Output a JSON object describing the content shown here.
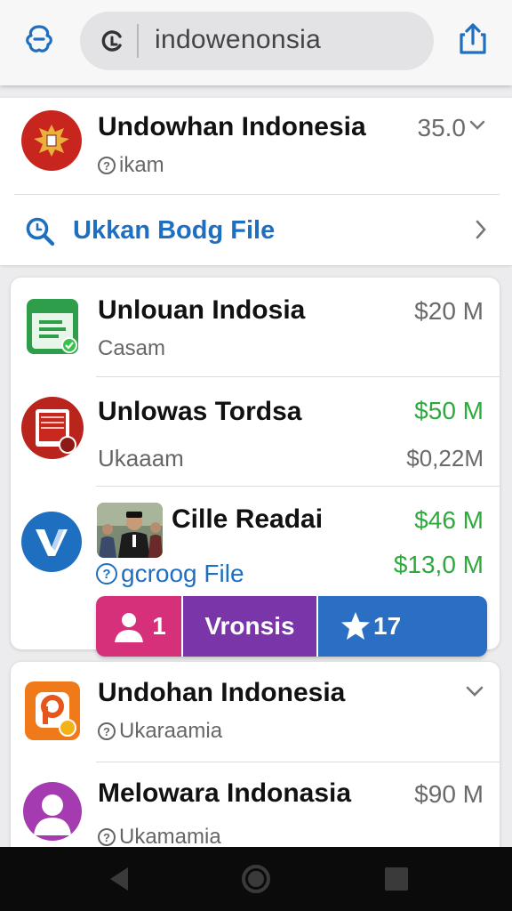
{
  "browser": {
    "url_text": "indowenonsia",
    "left_icon": "sync-icon",
    "url_icon": "reload-icon",
    "right_icon": "share-icon"
  },
  "card1": {
    "title": "Undowhan Indonesia",
    "subtitle": "ikam",
    "price": "35.0",
    "link_label": "Ukkan Bodg File"
  },
  "card2": {
    "rows": [
      {
        "title": "Unlouan Indosia",
        "subtitle": "Casam",
        "price": "$20 M"
      },
      {
        "title": "Unlowas Tordsa",
        "subtitle": "Ukaaam",
        "price": "$50 M",
        "price2": "$0,22M"
      },
      {
        "title": "Cille Readai",
        "subtitle": "gcroog File",
        "price": "$46 M",
        "price2": "$13,0 M"
      }
    ],
    "actions": {
      "count": "1",
      "middle": "Vronsis",
      "star_count": "17"
    }
  },
  "card3": {
    "rows": [
      {
        "title": "Undohan Indonesia",
        "subtitle": "Ukaraamia"
      },
      {
        "title": "Melowara Indonasia",
        "subtitle": "Ukamamia",
        "price": "$90 M"
      }
    ]
  },
  "colors": {
    "accent_blue": "#1f6fc0",
    "green_price": "#2eaa3c",
    "pink": "#d6307a",
    "purple": "#7a35a8",
    "blue": "#2a6fc4"
  }
}
